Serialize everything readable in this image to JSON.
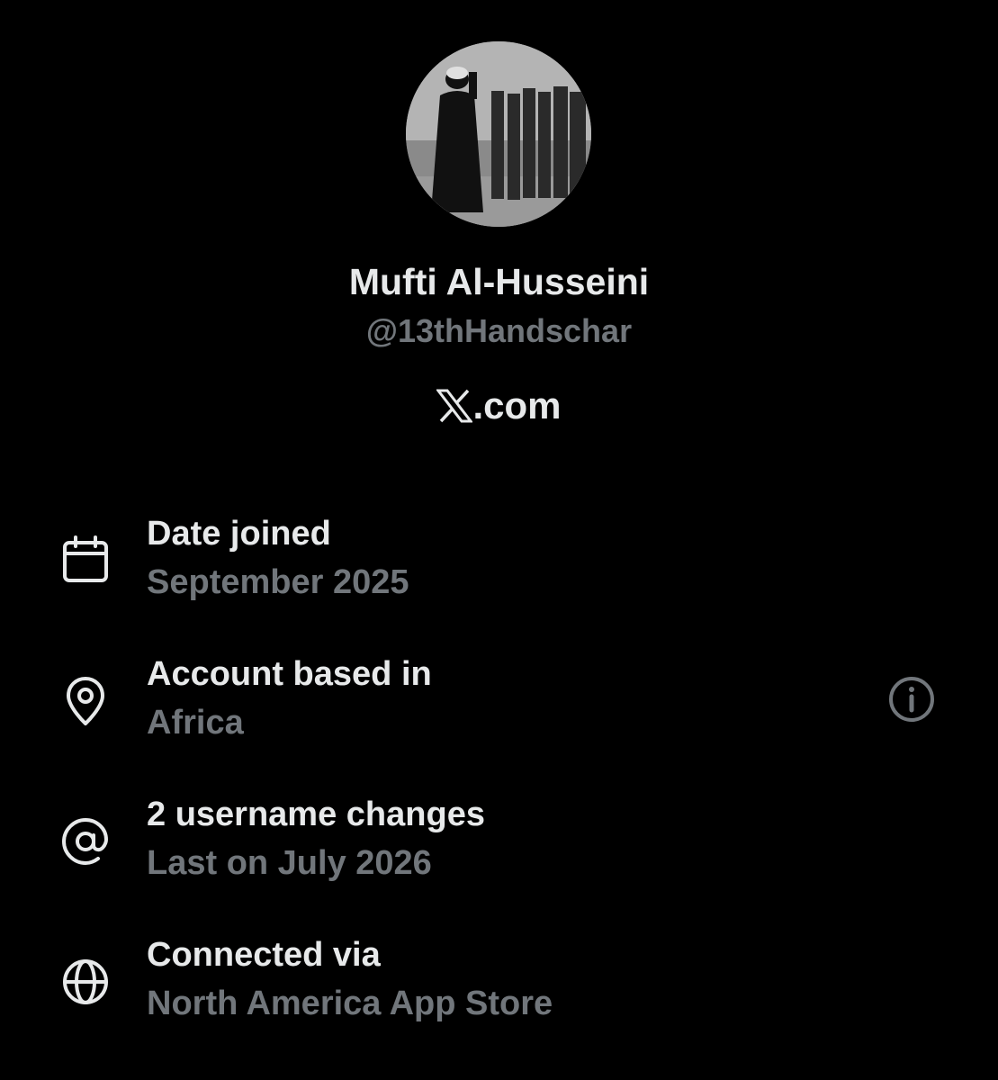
{
  "profile": {
    "display_name": "Mufti Al-Husseini",
    "handle": "@13thHandschar",
    "site": ".com"
  },
  "details": [
    {
      "icon": "calendar-icon",
      "title": "Date joined",
      "value": "September 2025"
    },
    {
      "icon": "location-pin-icon",
      "title": "Account based in",
      "value": "Africa"
    },
    {
      "icon": "at-sign-icon",
      "title": "2 username changes",
      "value": "Last on July 2026"
    },
    {
      "icon": "globe-icon",
      "title": "Connected via",
      "value": "North America App Store"
    }
  ],
  "colors": {
    "background": "#000000",
    "primary_text": "#e7e9ea",
    "secondary_text": "#71767b",
    "icon": "#e7e9ea",
    "info_icon": "#71767b"
  }
}
